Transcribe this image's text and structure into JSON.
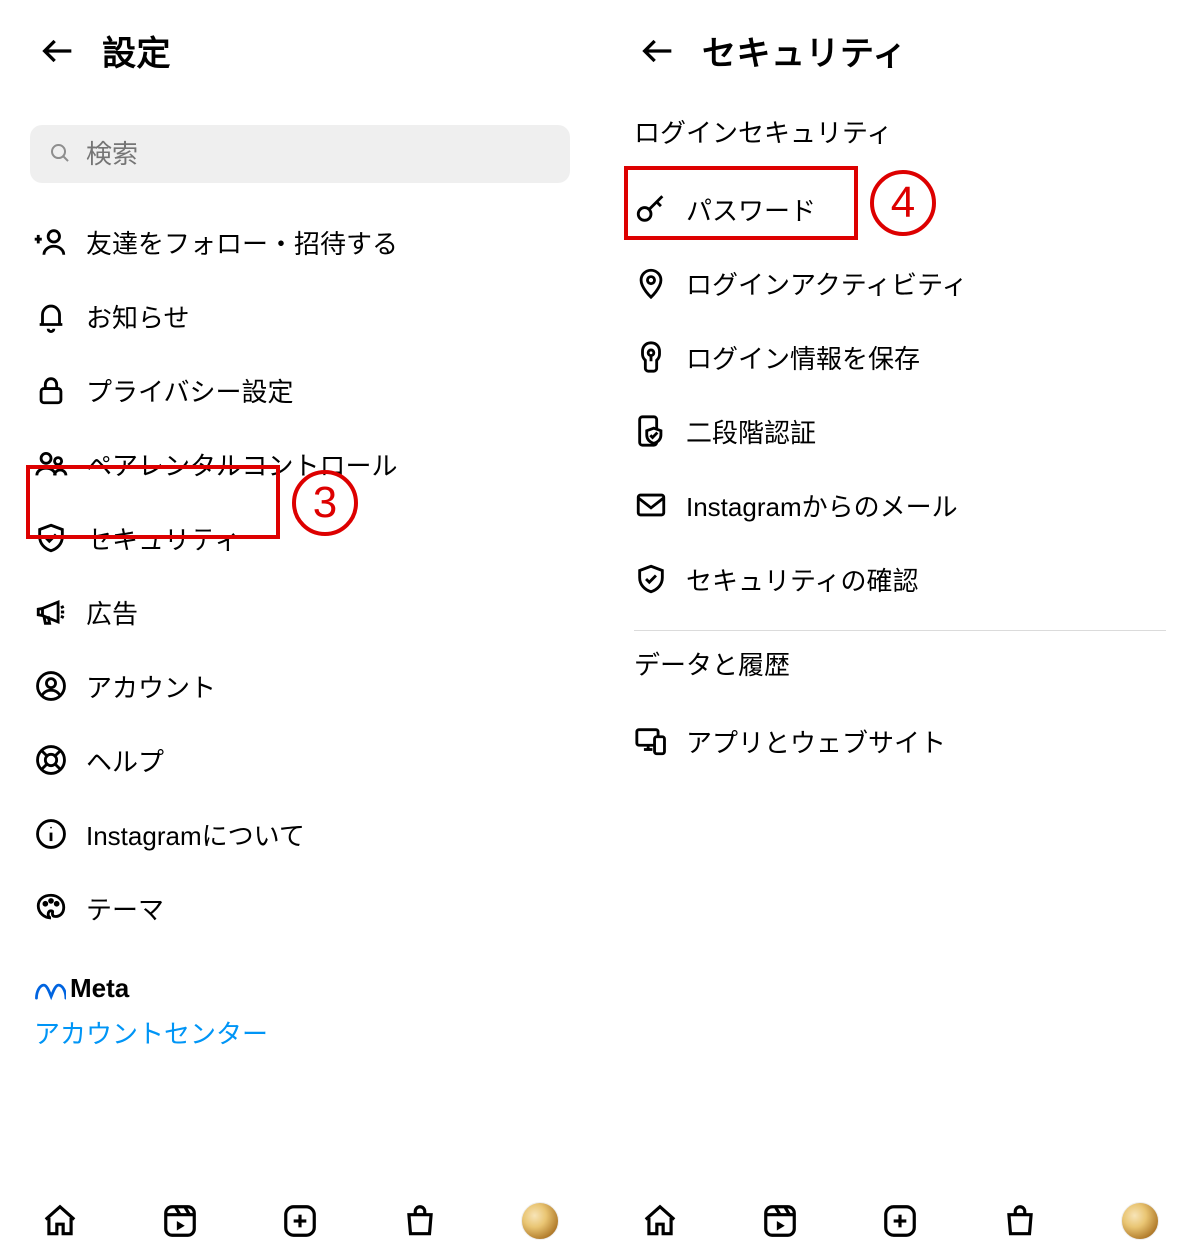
{
  "left": {
    "title": "設定",
    "search_placeholder": "検索",
    "items": [
      {
        "label": "友達をフォロー・招待する"
      },
      {
        "label": "お知らせ"
      },
      {
        "label": "プライバシー設定"
      },
      {
        "label": "ペアレンタルコントロール"
      },
      {
        "label": "セキュリティ"
      },
      {
        "label": "広告"
      },
      {
        "label": "アカウント"
      },
      {
        "label": "ヘルプ"
      },
      {
        "label": "Instagramについて"
      },
      {
        "label": "テーマ"
      }
    ],
    "meta_text": "Meta",
    "link_text": "アカウントセンター"
  },
  "right": {
    "title": "セキュリティ",
    "section_login": "ログインセキュリティ",
    "login_items": [
      {
        "label": "パスワード"
      },
      {
        "label": "ログインアクティビティ"
      },
      {
        "label": "ログイン情報を保存"
      },
      {
        "label": "二段階認証"
      },
      {
        "label": "Instagramからのメール"
      },
      {
        "label": "セキュリティの確認"
      }
    ],
    "section_data": "データと履歴",
    "data_items": [
      {
        "label": "アプリとウェブサイト"
      }
    ]
  },
  "annotations": {
    "n3": "3",
    "n4": "4"
  }
}
